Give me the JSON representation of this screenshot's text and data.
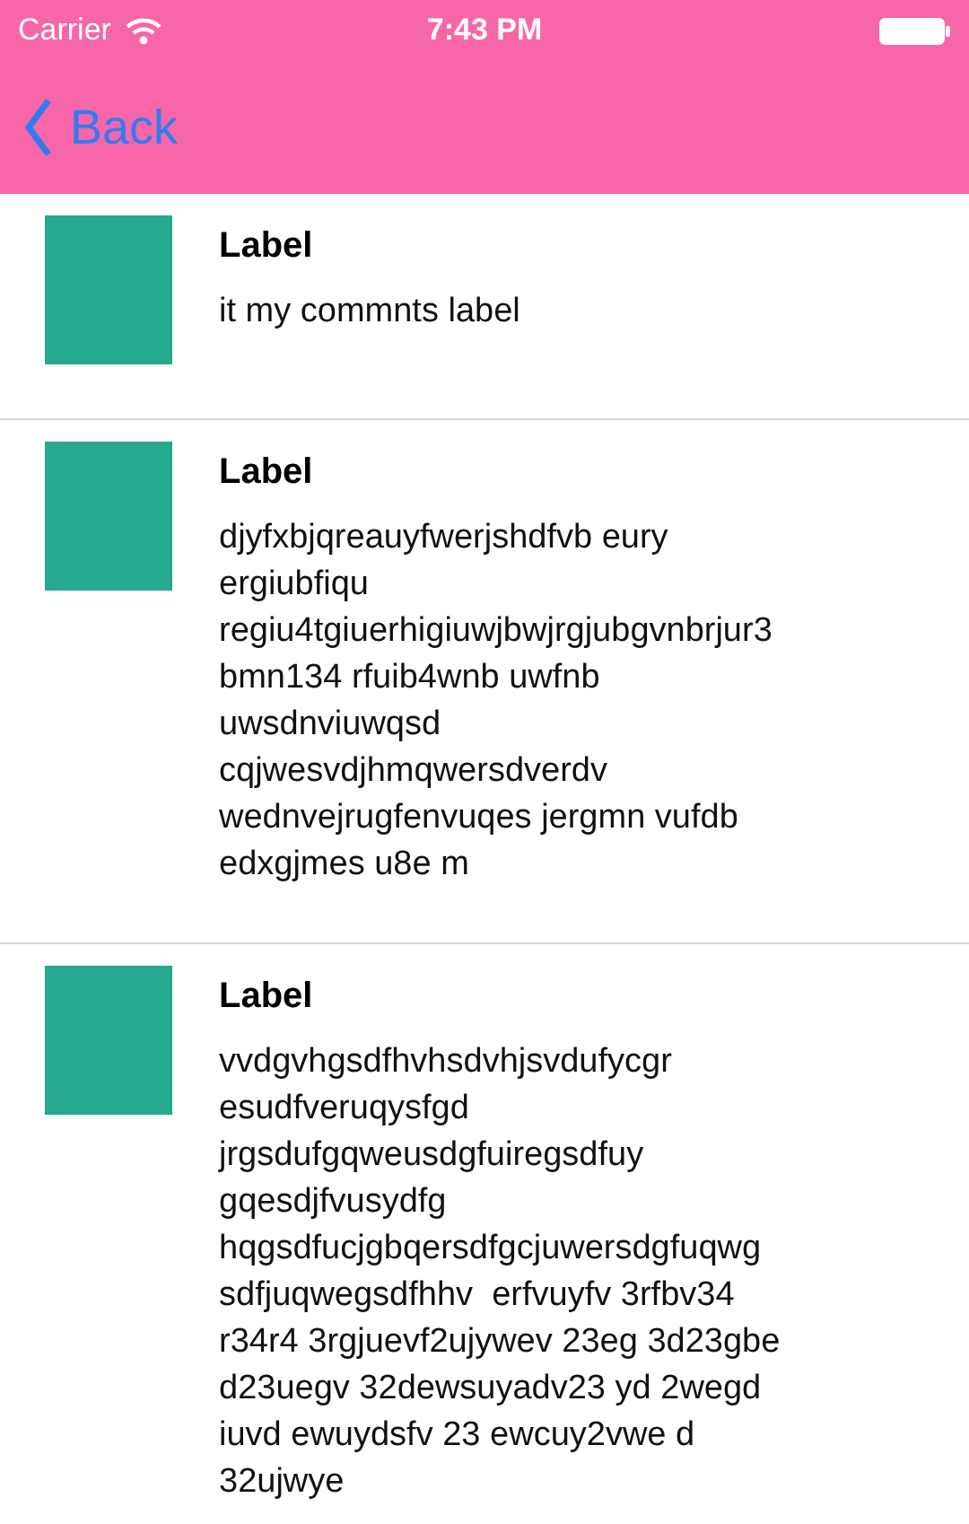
{
  "status_bar": {
    "carrier": "Carrier",
    "time": "7:43 PM"
  },
  "nav_bar": {
    "back": "Back"
  },
  "rows": [
    {
      "title": "Label",
      "comment": "it my commnts label"
    },
    {
      "title": "Label",
      "comment": "djyfxbjqreauyfwerjshdfvb eury\nergiubfiqu\nregiu4tgiuerhigiuwjbwjrgjubgvnbrjur3\nbmn134 rfuib4wnb uwfnb\nuwsdnviuwqsd\ncqjwesvdjhmqwersdverdv\nwednvejrugfenvuqes jergmn vufdb\nedxgjmes u8e m"
    },
    {
      "title": "Label",
      "comment": "vvdgvhgsdfhvhsdvhjsvdufycgr\nesudfveruqysfgd\njrgsdufgqweusdgfuiregsdfuy\ngqesdjfvusydfg\nhqgsdfucjgbqersdfgcjuwersdgfuqwg\nsdfjuqwegsdfhhv  erfvuyfv 3rfbv34\nr34r4 3rgjuevf2ujywev 23eg 3d23gbe\nd23uegv 32dewsuyadv23 yd 2wegd\niuvd ewuydsfv 23 ewcuy2vwe d\n32ujwye"
    }
  ]
}
